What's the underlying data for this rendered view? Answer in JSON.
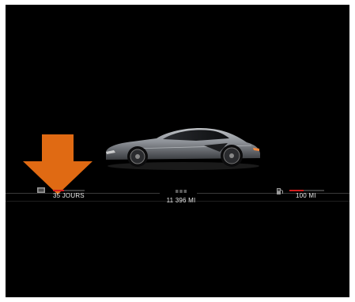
{
  "dashboard": {
    "service": {
      "icon": "service-wrench-icon",
      "value": "35 JOURS",
      "bar_fraction": 0.35,
      "bar_color": "#d21d1d"
    },
    "odometer": {
      "icon": "odometer-dots-icon",
      "value": "11 396 MI"
    },
    "fuel_range": {
      "icon": "fuel-pump-icon",
      "value": "100 MI",
      "bar_fraction": 0.4,
      "bar_color": "#d21d1d"
    },
    "vehicle_image": "sports-car-illustration",
    "callout": {
      "icon": "down-arrow-icon",
      "color": "#e06a13"
    }
  }
}
